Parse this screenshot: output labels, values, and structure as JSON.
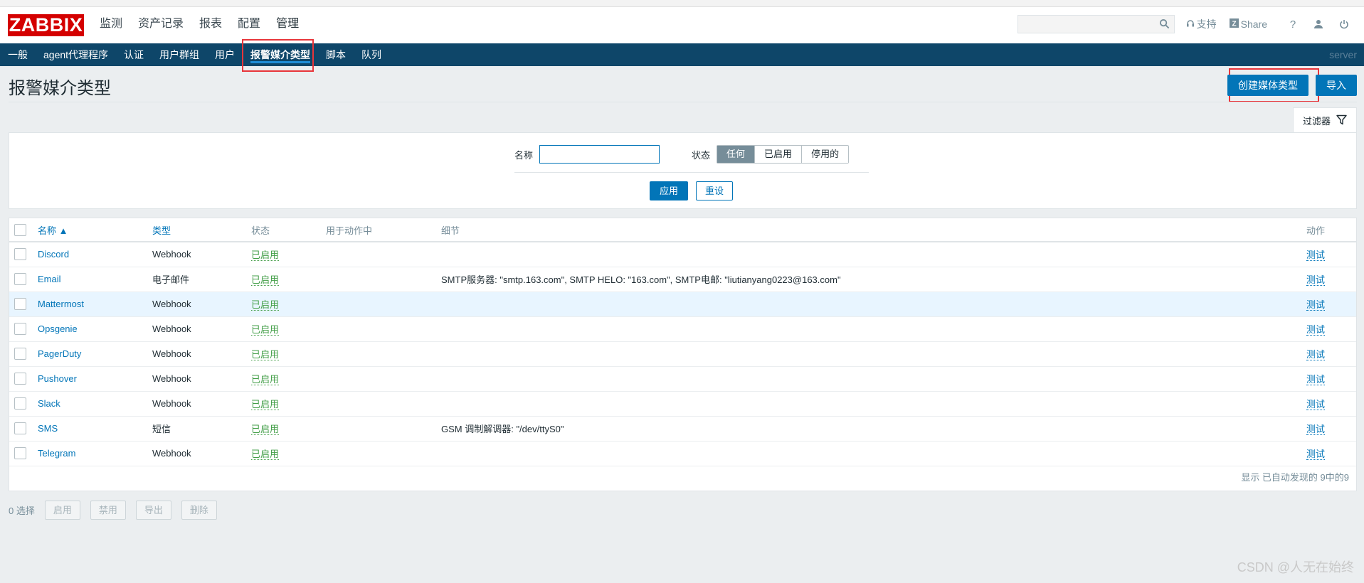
{
  "app": {
    "logo": "ZABBIX"
  },
  "main_nav": [
    "监测",
    "资产记录",
    "报表",
    "配置",
    "管理"
  ],
  "top_right": {
    "support": "支持",
    "share": "Share",
    "help": "?"
  },
  "sub_nav": [
    "一般",
    "agent代理程序",
    "认证",
    "用户群组",
    "用户",
    "报警媒介类型",
    "脚本",
    "队列"
  ],
  "server_label": "server",
  "page_title": "报警媒介类型",
  "buttons": {
    "create": "创建媒体类型",
    "import": "导入"
  },
  "filter": {
    "tab_label": "过滤器",
    "name_label": "名称",
    "name_value": "",
    "status_label": "状态",
    "status_options": [
      "任何",
      "已启用",
      "停用的"
    ],
    "status_selected": "任何",
    "apply": "应用",
    "reset": "重设"
  },
  "table": {
    "columns": [
      "名称 ▲",
      "类型",
      "状态",
      "用于动作中",
      "细节",
      "动作"
    ],
    "rows": [
      {
        "name": "Discord",
        "type": "Webhook",
        "status": "已启用",
        "used": "",
        "details": "",
        "action": "测试"
      },
      {
        "name": "Email",
        "type": "电子邮件",
        "status": "已启用",
        "used": "",
        "details": "SMTP服务器: \"smtp.163.com\", SMTP HELO: \"163.com\", SMTP电邮: \"liutianyang0223@163.com\"",
        "action": "测试"
      },
      {
        "name": "Mattermost",
        "type": "Webhook",
        "status": "已启用",
        "used": "",
        "details": "",
        "action": "测试"
      },
      {
        "name": "Opsgenie",
        "type": "Webhook",
        "status": "已启用",
        "used": "",
        "details": "",
        "action": "测试"
      },
      {
        "name": "PagerDuty",
        "type": "Webhook",
        "status": "已启用",
        "used": "",
        "details": "",
        "action": "测试"
      },
      {
        "name": "Pushover",
        "type": "Webhook",
        "status": "已启用",
        "used": "",
        "details": "",
        "action": "测试"
      },
      {
        "name": "Slack",
        "type": "Webhook",
        "status": "已启用",
        "used": "",
        "details": "",
        "action": "测试"
      },
      {
        "name": "SMS",
        "type": "短信",
        "status": "已启用",
        "used": "",
        "details": "GSM 调制解调器: \"/dev/ttyS0\"",
        "action": "测试"
      },
      {
        "name": "Telegram",
        "type": "Webhook",
        "status": "已启用",
        "used": "",
        "details": "",
        "action": "测试"
      }
    ],
    "footer": "显示 已自动发现的 9中的9"
  },
  "bottom": {
    "selected": "0 选择",
    "actions": [
      "启用",
      "禁用",
      "导出",
      "删除"
    ]
  },
  "watermark": "CSDN @人无在始终",
  "colors": {
    "nav_bg": "#0e4669",
    "accent": "#0275b8",
    "enabled": "#429e47",
    "logo_red": "#d40000"
  }
}
